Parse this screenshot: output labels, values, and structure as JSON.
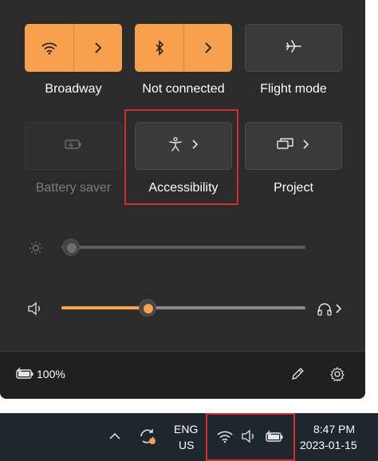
{
  "tiles": [
    {
      "label": "Broadway",
      "icon": "wifi-icon",
      "state": "on"
    },
    {
      "label": "Not connected",
      "icon": "bluetooth-icon",
      "state": "on"
    },
    {
      "label": "Flight mode",
      "icon": "airplane-icon",
      "state": "off"
    },
    {
      "label": "Battery saver",
      "icon": "battery-saver-icon",
      "state": "disabled"
    },
    {
      "label": "Accessibility",
      "icon": "accessibility-icon",
      "state": "off"
    },
    {
      "label": "Project",
      "icon": "project-icon",
      "state": "off"
    }
  ],
  "brightness": {
    "icon": "brightness-icon",
    "level": 0.03
  },
  "volume": {
    "icon": "speaker-icon",
    "level": 0.33,
    "output_icon": "headphones-icon"
  },
  "footer": {
    "battery_percent": "100%",
    "battery_icon": "battery-charging-icon",
    "edit_icon": "pencil-icon",
    "settings_icon": "gear-icon"
  },
  "taskbar": {
    "language_line1": "ENG",
    "language_line2": "US",
    "time": "8:47 PM",
    "date": "2023-01-15",
    "icons": [
      "chevron-up-icon",
      "sync-icon",
      "wifi-icon",
      "speaker-icon",
      "battery-charging-icon"
    ]
  },
  "colors": {
    "accent": "#f7a04e",
    "panel": "#2b2b2b",
    "highlight": "#d72c2c",
    "taskbar": "#1e2630"
  }
}
